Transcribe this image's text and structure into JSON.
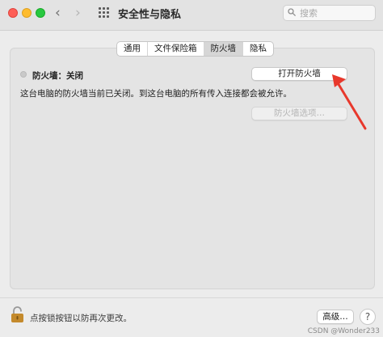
{
  "window": {
    "title": "安全性与隐私",
    "controls": [
      "close",
      "minimize",
      "zoom"
    ]
  },
  "toolbar": {
    "back_icon": "chevron-left-icon",
    "forward_icon": "chevron-right-icon",
    "grid_icon": "grid-icon",
    "search_placeholder": "搜索",
    "search_value": ""
  },
  "tabs": [
    {
      "label": "通用",
      "active": false
    },
    {
      "label": "文件保险箱",
      "active": false
    },
    {
      "label": "防火墙",
      "active": true
    },
    {
      "label": "隐私",
      "active": false
    }
  ],
  "firewall": {
    "status": "防火墙：关闭",
    "turn_on_label": "打开防火墙",
    "description": "这台电脑的防火墙当前已关闭。到这台电脑的所有传入连接都会被允许。",
    "options_label": "防火墙选项…"
  },
  "footer": {
    "lock_text": "点按锁按钮以防再次更改。",
    "advanced_label": "高级…",
    "help_label": "?"
  },
  "watermark": "CSDN @Wonder233",
  "colors": {
    "close": "#fe5f57",
    "minimize": "#febc2e",
    "zoom": "#28c840",
    "annotation_arrow": "#e8382c",
    "lock": "#c48a2c"
  }
}
